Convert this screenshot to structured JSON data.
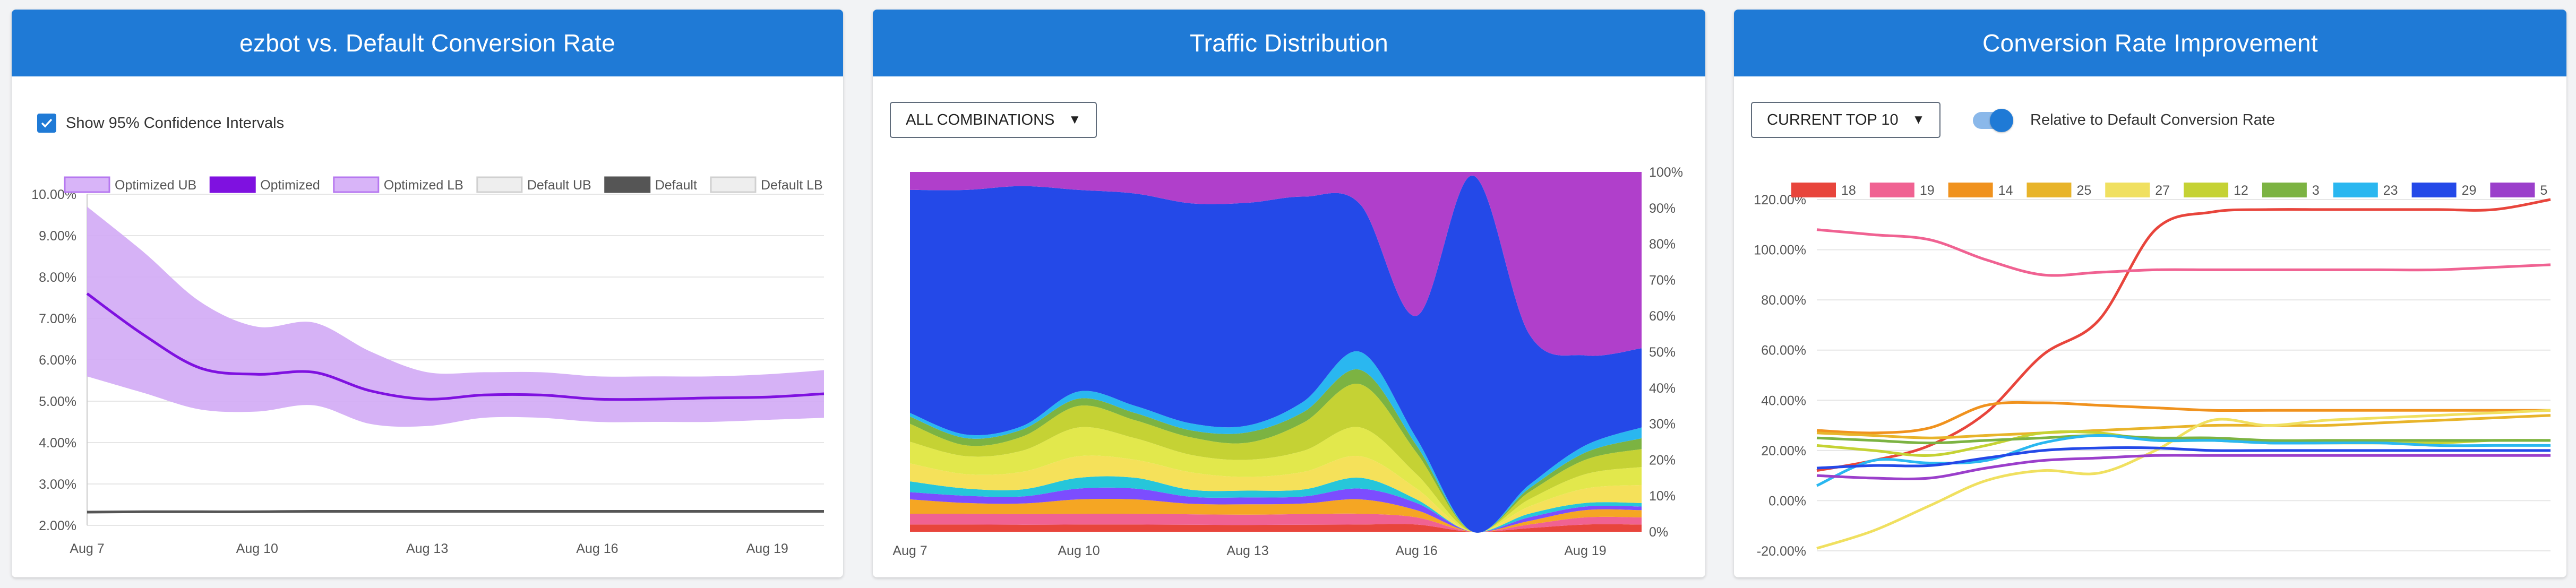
{
  "panels": {
    "p1": {
      "title": "ezbot vs. Default Conversion Rate",
      "checkbox_label": "Show 95% Confidence Intervals",
      "checkbox_checked": true
    },
    "p2": {
      "title": "Traffic Distribution",
      "dropdown_label": "ALL COMBINATIONS"
    },
    "p3": {
      "title": "Conversion Rate Improvement",
      "dropdown_label": "CURRENT TOP 10",
      "toggle_label": "Relative to Default Conversion Rate",
      "toggle_on": true
    }
  },
  "chart_data": [
    {
      "type": "line",
      "x_ticks": [
        "Aug 7",
        "Aug 10",
        "Aug 13",
        "Aug 16",
        "Aug 19"
      ],
      "x": [
        7,
        8,
        9,
        10,
        11,
        12,
        13,
        14,
        15,
        16,
        17,
        18,
        19,
        20
      ],
      "ylim": [
        2,
        10
      ],
      "y_ticks": [
        "10.00%",
        "9.00%",
        "8.00%",
        "7.00%",
        "6.00%",
        "5.00%",
        "4.00%",
        "3.00%",
        "2.00%"
      ],
      "legend_position": "top",
      "series": [
        {
          "name": "Optimized UB",
          "color": "#d8b4f8",
          "values": [
            9.7,
            8.6,
            7.4,
            6.8,
            6.9,
            6.2,
            5.7,
            5.7,
            5.7,
            5.6,
            5.6,
            5.6,
            5.65,
            5.75
          ]
        },
        {
          "name": "Optimized",
          "color": "#7f11e0",
          "values": [
            7.6,
            6.6,
            5.8,
            5.65,
            5.7,
            5.25,
            5.05,
            5.15,
            5.15,
            5.05,
            5.05,
            5.08,
            5.1,
            5.18
          ]
        },
        {
          "name": "Optimized LB",
          "color": "#d8b4f8",
          "values": [
            5.6,
            5.2,
            4.8,
            4.75,
            4.9,
            4.45,
            4.4,
            4.6,
            4.6,
            4.5,
            4.5,
            4.5,
            4.55,
            4.6
          ]
        },
        {
          "name": "Default UB",
          "color": "#eeeeee",
          "values": [
            2.34,
            2.34,
            2.34,
            2.34,
            2.34,
            2.34,
            2.34,
            2.34,
            2.34,
            2.34,
            2.34,
            2.34,
            2.34,
            2.34
          ]
        },
        {
          "name": "Default",
          "color": "#555555",
          "values": [
            2.32,
            2.33,
            2.33,
            2.33,
            2.34,
            2.34,
            2.34,
            2.34,
            2.34,
            2.34,
            2.34,
            2.34,
            2.34,
            2.34
          ]
        },
        {
          "name": "Default LB",
          "color": "#eeeeee",
          "values": [
            2.3,
            2.3,
            2.3,
            2.3,
            2.3,
            2.3,
            2.3,
            2.3,
            2.3,
            2.3,
            2.3,
            2.3,
            2.3,
            2.3
          ]
        }
      ]
    },
    {
      "type": "area",
      "stacked": "percent",
      "x_ticks": [
        "Aug 7",
        "Aug 10",
        "Aug 13",
        "Aug 16",
        "Aug 19"
      ],
      "x": [
        7,
        8,
        9,
        10,
        11,
        12,
        13,
        14,
        15,
        16,
        17,
        18,
        19,
        20
      ],
      "ylim": [
        0,
        100
      ],
      "y_ticks": [
        "100%",
        "90%",
        "80%",
        "70%",
        "60%",
        "50%",
        "40%",
        "30%",
        "20%",
        "10%",
        "0%"
      ],
      "series": [
        {
          "color": "#e8453c",
          "values": [
            2,
            2,
            2,
            2,
            2,
            2,
            2,
            2,
            2,
            2,
            0,
            1,
            2,
            2
          ]
        },
        {
          "color": "#f06292",
          "values": [
            3,
            3,
            3,
            3,
            3,
            3,
            3,
            3,
            3,
            2,
            0,
            1,
            2,
            2
          ]
        },
        {
          "color": "#f5a623",
          "values": [
            4,
            3,
            3,
            4,
            4,
            3,
            3,
            3,
            4,
            2,
            0,
            1,
            2,
            2
          ]
        },
        {
          "color": "#7c4dff",
          "values": [
            2,
            2,
            2,
            3,
            3,
            2,
            2,
            2,
            3,
            2,
            0,
            1,
            1,
            1
          ]
        },
        {
          "color": "#26c6da",
          "values": [
            3,
            2,
            2,
            3,
            3,
            2,
            2,
            2,
            3,
            1,
            0,
            1,
            1,
            1
          ]
        },
        {
          "color": "#f5e15a",
          "values": [
            5,
            4,
            5,
            6,
            5,
            5,
            4,
            5,
            6,
            3,
            0,
            2,
            4,
            5
          ]
        },
        {
          "color": "#e2e84c",
          "values": [
            6,
            5,
            6,
            8,
            6,
            5,
            5,
            6,
            8,
            4,
            0,
            2,
            4,
            5
          ]
        },
        {
          "color": "#c5d234",
          "values": [
            5,
            3,
            4,
            6,
            5,
            5,
            5,
            8,
            12,
            6,
            0,
            2,
            4,
            5
          ]
        },
        {
          "color": "#7cb342",
          "values": [
            2,
            2,
            2,
            2,
            2,
            2,
            3,
            3,
            4,
            2,
            0,
            1,
            2,
            3
          ]
        },
        {
          "color": "#2ab7f0",
          "values": [
            1,
            1,
            1,
            2,
            2,
            2,
            2,
            3,
            5,
            2,
            0,
            1,
            2,
            3
          ]
        },
        {
          "color": "#2449e8",
          "values": [
            62,
            68,
            68,
            56,
            59,
            63,
            65,
            58,
            41,
            34,
            99,
            42,
            25,
            22
          ]
        },
        {
          "color": "#b03fcb",
          "values": [
            5,
            5,
            4,
            5,
            6,
            9,
            9,
            7,
            9,
            40,
            1,
            45,
            51,
            49
          ]
        }
      ]
    },
    {
      "type": "line",
      "x_ticks": [],
      "x": [
        7,
        8,
        9,
        10,
        11,
        12,
        13,
        14,
        15,
        16,
        17,
        18,
        19,
        20
      ],
      "ylim": [
        -20,
        120
      ],
      "y_ticks": [
        "120.00%",
        "100.00%",
        "80.00%",
        "60.00%",
        "40.00%",
        "20.00%",
        "0.00%",
        "-20.00%"
      ],
      "legend_position": "top",
      "series": [
        {
          "name": "18",
          "color": "#e8453c",
          "values": [
            12,
            16,
            22,
            35,
            58,
            72,
            108,
            115,
            116,
            116,
            116,
            116,
            116,
            120
          ]
        },
        {
          "name": "19",
          "color": "#f06292",
          "values": [
            108,
            106,
            104,
            96,
            90,
            91,
            92,
            92,
            92,
            92,
            92,
            92,
            93,
            94
          ]
        },
        {
          "name": "14",
          "color": "#f0921e",
          "values": [
            28,
            27,
            29,
            38,
            39,
            38,
            37,
            36,
            36,
            36,
            36,
            36,
            36,
            36
          ]
        },
        {
          "name": "25",
          "color": "#e8b42a",
          "values": [
            27,
            26,
            25,
            26,
            27,
            28,
            29,
            30,
            30,
            30,
            31,
            32,
            33,
            34
          ]
        },
        {
          "name": "27",
          "color": "#f0e060",
          "values": [
            -19,
            -12,
            -2,
            8,
            12,
            11,
            20,
            32,
            30,
            32,
            33,
            34,
            35,
            36
          ]
        },
        {
          "name": "12",
          "color": "#c5d234",
          "values": [
            22,
            20,
            18,
            22,
            27,
            27,
            24,
            24,
            23,
            23,
            23,
            23,
            24,
            24
          ]
        },
        {
          "name": "3",
          "color": "#7cb342",
          "values": [
            25,
            24,
            23,
            24,
            25,
            26,
            25,
            25,
            24,
            24,
            24,
            24,
            24,
            24
          ]
        },
        {
          "name": "23",
          "color": "#2ab7f0",
          "values": [
            6,
            16,
            15,
            16,
            23,
            26,
            24,
            24,
            23,
            23,
            23,
            22,
            22,
            22
          ]
        },
        {
          "name": "29",
          "color": "#2449e8",
          "values": [
            13,
            14,
            14,
            17,
            20,
            21,
            21,
            20,
            20,
            20,
            20,
            20,
            20,
            20
          ]
        },
        {
          "name": "5",
          "color": "#9b3fcb",
          "values": [
            10,
            9,
            9,
            13,
            16,
            17,
            18,
            18,
            18,
            18,
            18,
            18,
            18,
            18
          ]
        }
      ]
    }
  ]
}
